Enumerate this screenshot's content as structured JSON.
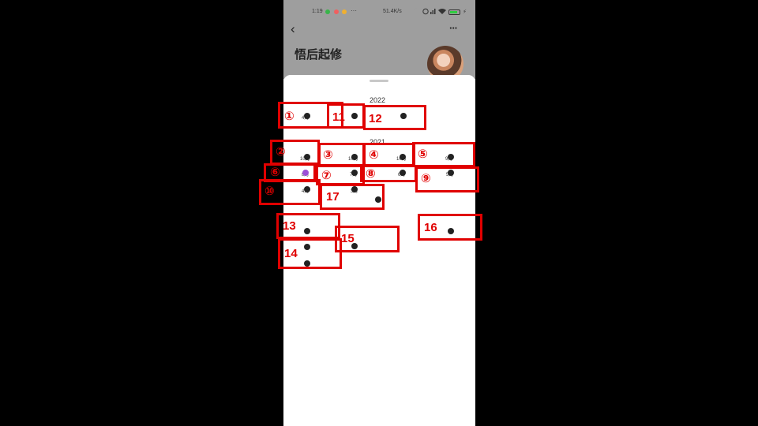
{
  "status_bar": {
    "time": "1:19",
    "more": "···",
    "network": "51.4K/s"
  },
  "header": {
    "back_icon": "back-arrow-icon",
    "title": "悟后起修",
    "more": "···"
  },
  "years": [
    "2022",
    "2021"
  ],
  "months": [
    "4月",
    "10月",
    "10月",
    "10月",
    "9月",
    "8月",
    "7月",
    "6月",
    "5月",
    "4月",
    "3月"
  ],
  "colors": {
    "annotation": "#e00000",
    "highlight_dot": "#9b4fd6"
  },
  "annotations": [
    "①",
    "②",
    "③",
    "④",
    "⑤",
    "⑥",
    "⑦",
    "⑧",
    "⑨",
    "⑩",
    "11",
    "12",
    "13",
    "14",
    "15",
    "16",
    "17"
  ]
}
